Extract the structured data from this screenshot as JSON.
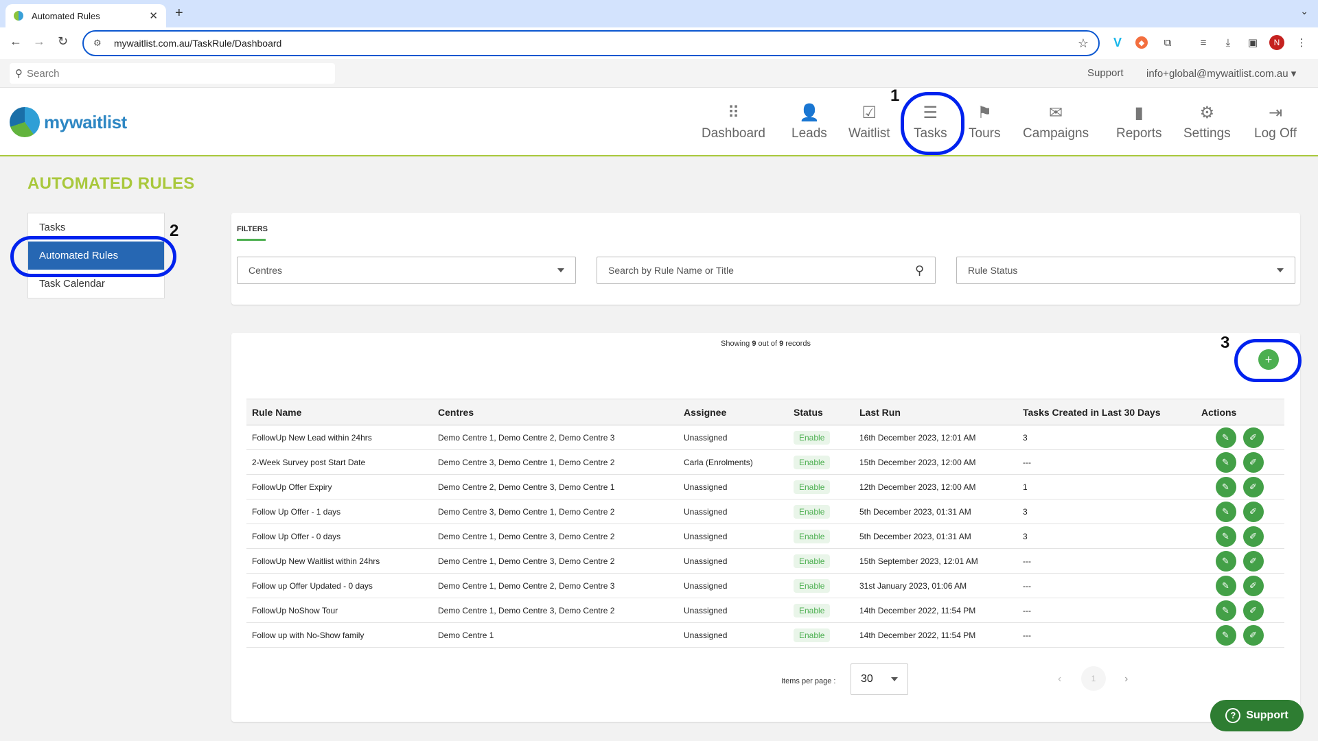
{
  "browser": {
    "tab_title": "Automated Rules",
    "url": "mywaitlist.com.au/TaskRule/Dashboard",
    "profile_initial": "N"
  },
  "topstrip": {
    "search_placeholder": "Search",
    "support": "Support",
    "account": "info+global@mywaitlist.com.au"
  },
  "logo_text": "mywaitlist",
  "nav": [
    {
      "label": "Dashboard",
      "icon": "grid-icon"
    },
    {
      "label": "Leads",
      "icon": "user-plus-icon"
    },
    {
      "label": "Waitlist",
      "icon": "inbox-icon"
    },
    {
      "label": "Tasks",
      "icon": "list-icon"
    },
    {
      "label": "Tours",
      "icon": "map-icon"
    },
    {
      "label": "Campaigns",
      "icon": "mail-check-icon"
    },
    {
      "label": "Reports",
      "icon": "bar-chart-icon"
    },
    {
      "label": "Settings",
      "icon": "gear-icon"
    },
    {
      "label": "Log Off",
      "icon": "logout-icon"
    }
  ],
  "annotations": [
    "1",
    "2",
    "3"
  ],
  "page_title": "AUTOMATED RULES",
  "sidebar": [
    "Tasks",
    "Automated Rules",
    "Task Calendar"
  ],
  "filters": {
    "label": "FILTERS",
    "centres": "Centres",
    "search_placeholder": "Search by Rule Name or Title",
    "status": "Rule Status"
  },
  "records": {
    "prefix": "Showing ",
    "shown": "9",
    "middle": " out of ",
    "total": "9",
    "suffix": " records"
  },
  "add_button": "+",
  "table": {
    "headers": [
      "Rule Name",
      "Centres",
      "Assignee",
      "Status",
      "Last Run",
      "Tasks Created in Last 30 Days",
      "Actions"
    ],
    "rows": [
      [
        "FollowUp New Lead within 24hrs",
        "Demo Centre 1, Demo Centre 2, Demo Centre 3",
        "Unassigned",
        "Enable",
        "16th December 2023, 12:01 AM",
        "3"
      ],
      [
        "2-Week Survey post Start Date",
        "Demo Centre 3, Demo Centre 1, Demo Centre 2",
        "Carla (Enrolments)",
        "Enable",
        "15th December 2023, 12:00 AM",
        "---"
      ],
      [
        "FollowUp Offer Expiry",
        "Demo Centre 2, Demo Centre 3, Demo Centre 1",
        "Unassigned",
        "Enable",
        "12th December 2023, 12:00 AM",
        "1"
      ],
      [
        "Follow Up Offer - 1 days",
        "Demo Centre 3, Demo Centre 1, Demo Centre 2",
        "Unassigned",
        "Enable",
        "5th December 2023, 01:31 AM",
        "3"
      ],
      [
        "Follow Up Offer - 0 days",
        "Demo Centre 1, Demo Centre 3, Demo Centre 2",
        "Unassigned",
        "Enable",
        "5th December 2023, 01:31 AM",
        "3"
      ],
      [
        "FollowUp New Waitlist within 24hrs",
        "Demo Centre 1, Demo Centre 3, Demo Centre 2",
        "Unassigned",
        "Enable",
        "15th September 2023, 12:01 AM",
        "---"
      ],
      [
        "Follow up Offer Updated - 0 days",
        "Demo Centre 1, Demo Centre 2, Demo Centre 3",
        "Unassigned",
        "Enable",
        "31st January 2023, 01:06 AM",
        "---"
      ],
      [
        "FollowUp NoShow Tour",
        "Demo Centre 1, Demo Centre 3, Demo Centre 2",
        "Unassigned",
        "Enable",
        "14th December 2022, 11:54 PM",
        "---"
      ],
      [
        "Follow up with No-Show family",
        "Demo Centre 1",
        "Unassigned",
        "Enable",
        "14th December 2022, 11:54 PM",
        "---"
      ]
    ]
  },
  "pagination": {
    "items_per_page_label": "Items per page :",
    "items_per_page": "30",
    "current_page": "1"
  },
  "support_fab": "Support",
  "colors": {
    "brand_green": "#a9c83c",
    "brand_blue": "#2667b3",
    "action_green": "#43a047",
    "annotation_blue": "#0022ee"
  }
}
